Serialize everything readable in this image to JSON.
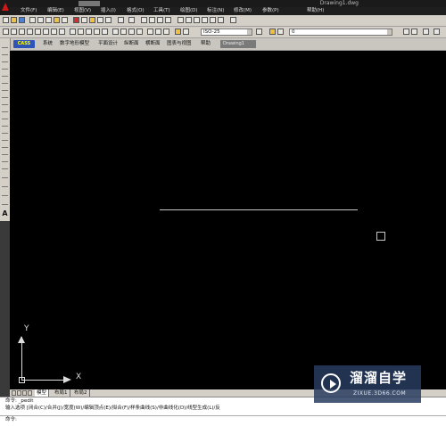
{
  "window": {
    "title": "Drawing1.dwg"
  },
  "menu": {
    "items": [
      "文件(F)",
      "编辑(E)",
      "视图(V)",
      "插入(I)",
      "格式(O)",
      "工具(T)",
      "绘图(D)",
      "标注(N)",
      "修改(M)",
      "参数(P)",
      "帮助(H)"
    ]
  },
  "toolbar": {
    "dimstyle": "ISO-25",
    "layer": "0"
  },
  "ribbon": {
    "logo": "CASS",
    "items": [
      "系统",
      "数字地形模型",
      "平面设计",
      "纵断面",
      "横断面",
      "图表与视图",
      "帮助"
    ],
    "document_tab": "Drawing1"
  },
  "drawbar": {
    "text_tool": "A"
  },
  "canvas": {
    "background": "#000000",
    "axis_x": "X",
    "axis_y": "Y"
  },
  "layout_tabs": {
    "items": [
      "模型",
      "布局1",
      "布局2"
    ],
    "active": 0
  },
  "command": {
    "lines": [
      "命令: _pedit",
      "输入选项 [闭合(C)/合并(J)/宽度(W)/编辑顶点(E)/拟合(F)/样条曲线(S)/非曲线化(D)/线型生成(L)/反",
      "命令:"
    ]
  },
  "watermark": {
    "brand": "溜溜自学",
    "url": "ZIXUE.3D66.COM",
    "color": "#283c5f"
  }
}
